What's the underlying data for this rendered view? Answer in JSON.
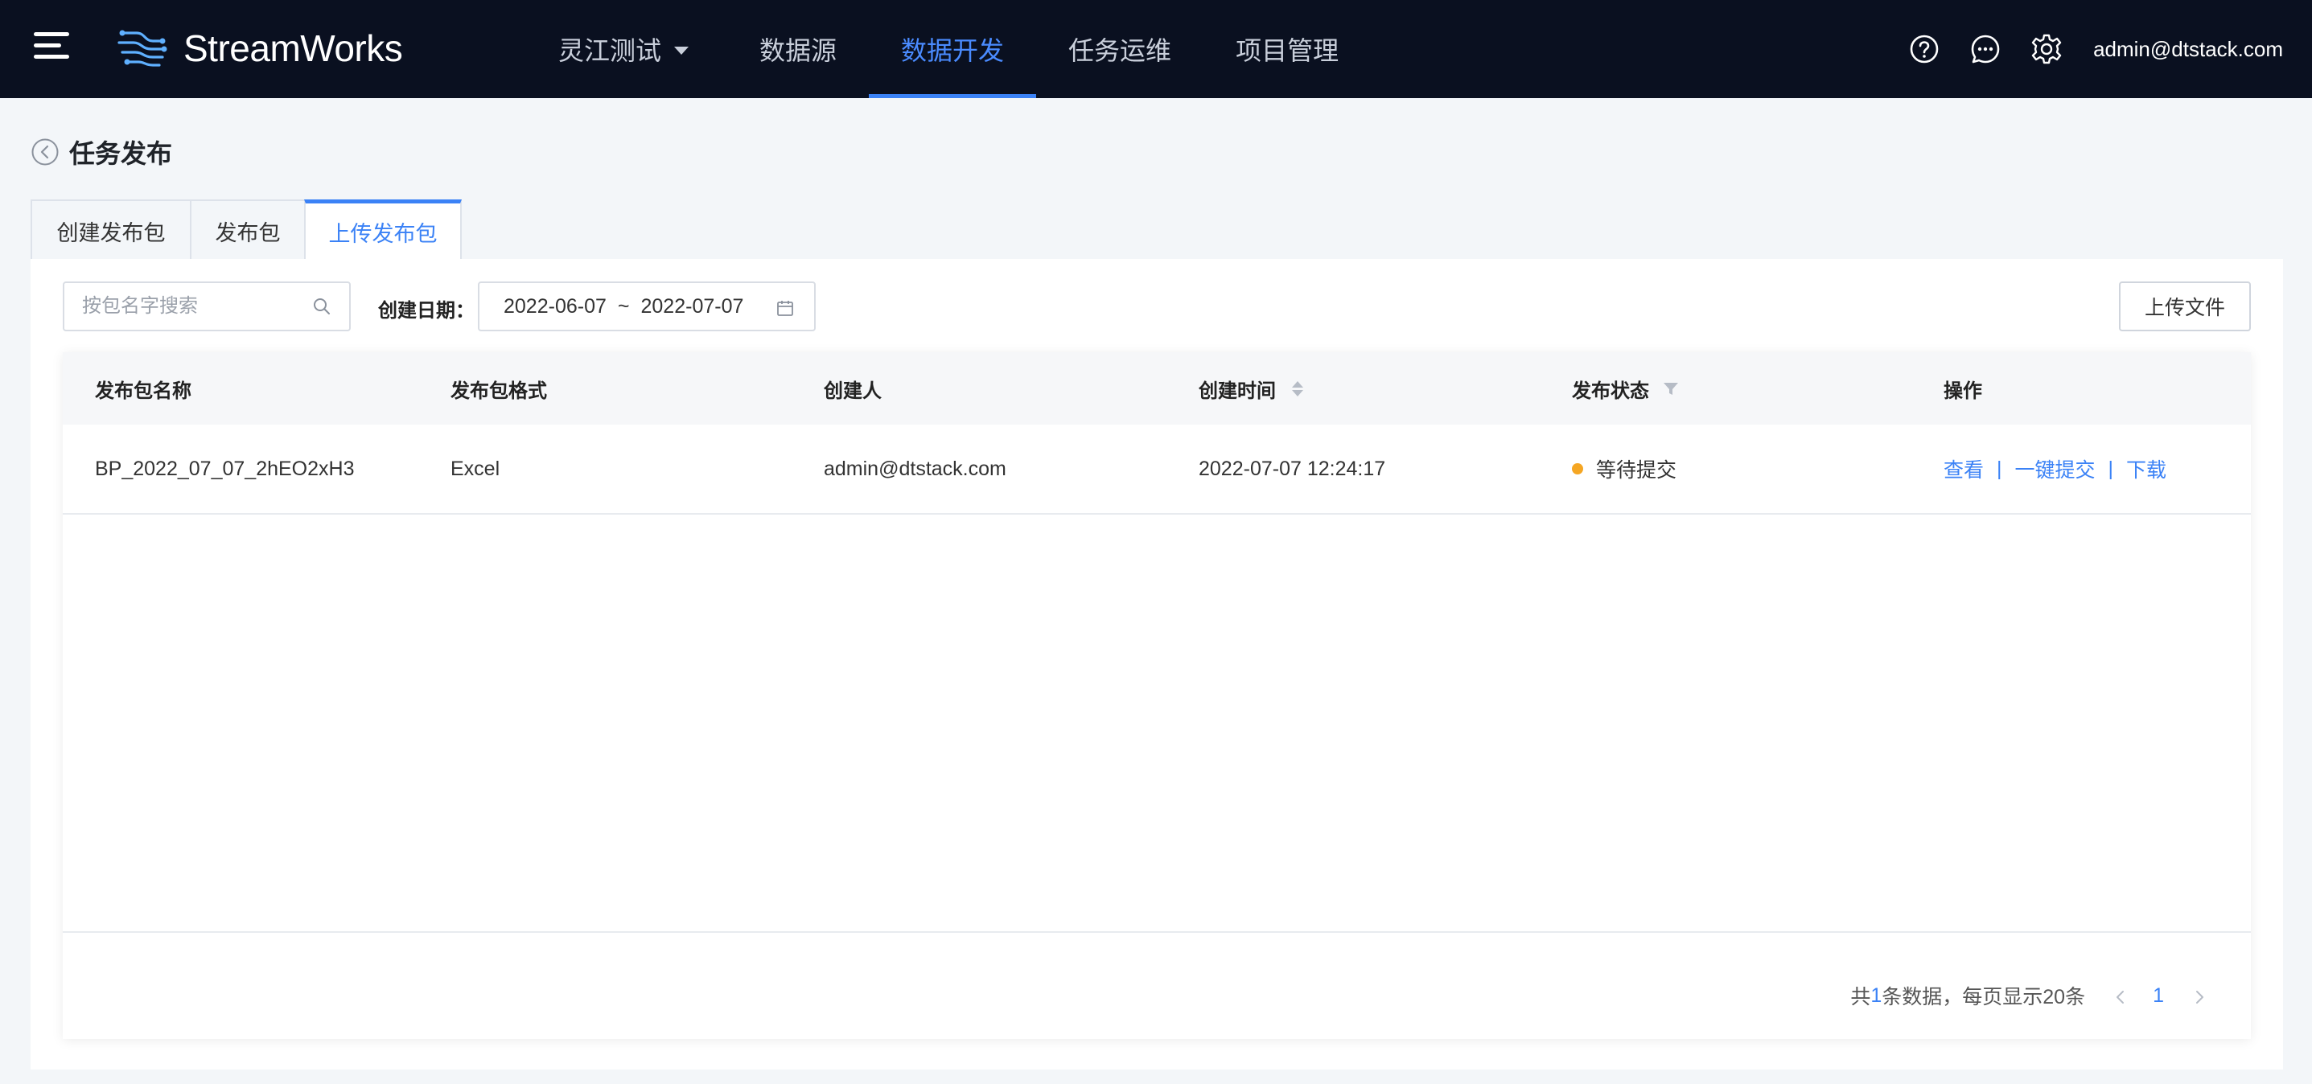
{
  "header": {
    "brand": "StreamWorks",
    "project": "灵江测试",
    "nav": [
      "数据源",
      "数据开发",
      "任务运维",
      "项目管理"
    ],
    "active_nav": "数据开发",
    "user": "admin@dtstack.com",
    "icons": [
      "menu-icon",
      "help-icon",
      "message-icon",
      "gear-icon"
    ]
  },
  "page": {
    "title": "任务发布",
    "tabs": [
      "创建发布包",
      "发布包",
      "上传发布包"
    ],
    "active_tab": "上传发布包"
  },
  "filters": {
    "search_placeholder": "按包名字搜索",
    "date_label": "创建日期：",
    "date_start": "2022-06-07",
    "date_sep": "~",
    "date_end": "2022-07-07",
    "upload_label": "上传文件"
  },
  "table": {
    "columns": [
      "发布包名称",
      "发布包格式",
      "创建人",
      "创建时间",
      "发布状态",
      "操作"
    ],
    "rows": [
      {
        "name": "BP_2022_07_07_2hEO2xH3",
        "format": "Excel",
        "creator": "admin@dtstack.com",
        "created_at": "2022-07-07 12:24:17",
        "status": "等待提交",
        "status_color": "#f5a623",
        "actions": [
          "查看",
          "一键提交",
          "下载"
        ]
      }
    ]
  },
  "pagination": {
    "prefix": "共",
    "total": "1",
    "suffix": "条数据，每页显示20条",
    "current_page": "1"
  },
  "colors": {
    "topbar": "#0a1020",
    "accent": "#3b82f6",
    "background": "#f3f6f9"
  }
}
